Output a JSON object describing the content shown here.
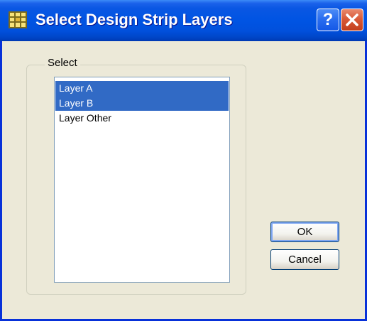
{
  "window": {
    "title": "Select Design Strip Layers",
    "help_label": "?",
    "app_icon": "grid-app-icon",
    "help_icon": "question-icon",
    "close_icon": "close-icon"
  },
  "group": {
    "label": "Select"
  },
  "layers": {
    "items": [
      {
        "label": "Layer A",
        "selected": true
      },
      {
        "label": "Layer B",
        "selected": true
      },
      {
        "label": "Layer Other",
        "selected": false
      }
    ]
  },
  "buttons": {
    "ok_label": "OK",
    "cancel_label": "Cancel"
  },
  "colors": {
    "titlebar": "#0054e3",
    "selection": "#316ac5",
    "dialog_bg": "#ece9d8",
    "close_button": "#d95a38"
  }
}
